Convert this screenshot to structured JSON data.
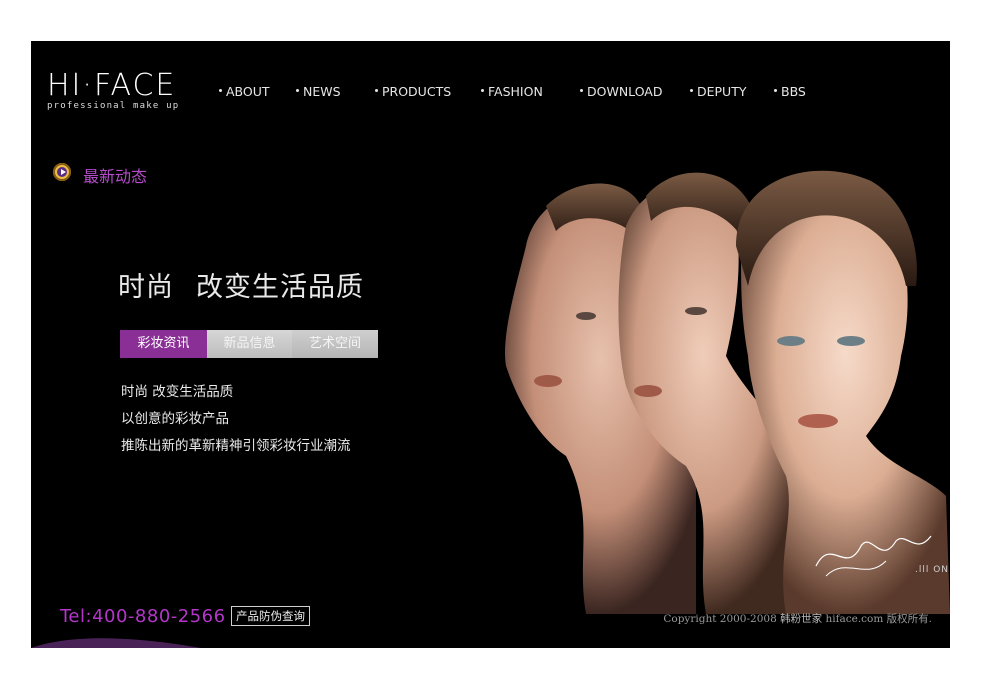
{
  "logo": {
    "mark": "HI·FACE",
    "tagline": "professional make up"
  },
  "nav": [
    {
      "label": "ABOUT"
    },
    {
      "label": "NEWS"
    },
    {
      "label": "PRODUCTS"
    },
    {
      "label": "FASHION"
    },
    {
      "label": "DOWNLOAD"
    },
    {
      "label": "DEPUTY"
    },
    {
      "label": "BBS"
    }
  ],
  "news": {
    "label": "最新动态"
  },
  "headline": {
    "part1": "时尚",
    "part2": "改变生活品质"
  },
  "tabs": [
    {
      "label": "彩妆资讯"
    },
    {
      "label": "新品信息"
    },
    {
      "label": "艺术空间"
    }
  ],
  "description": [
    "时尚 改变生活品质",
    "以创意的彩妆产品",
    "推陈出新的革新精神引领彩妆行业潮流"
  ],
  "footer": {
    "tel": "Tel:400-880-2566",
    "verify": "产品防伪查询",
    "copyright_prefix": "Copyright 2000-2008",
    "copyright_brand": "韩粉世家",
    "copyright_suffix": "hiface.com 版权所有.",
    "small_logo": ".lll ON"
  },
  "colors": {
    "accent": "#b336c8",
    "tab_active": "#8a2f95",
    "background": "#000000"
  }
}
